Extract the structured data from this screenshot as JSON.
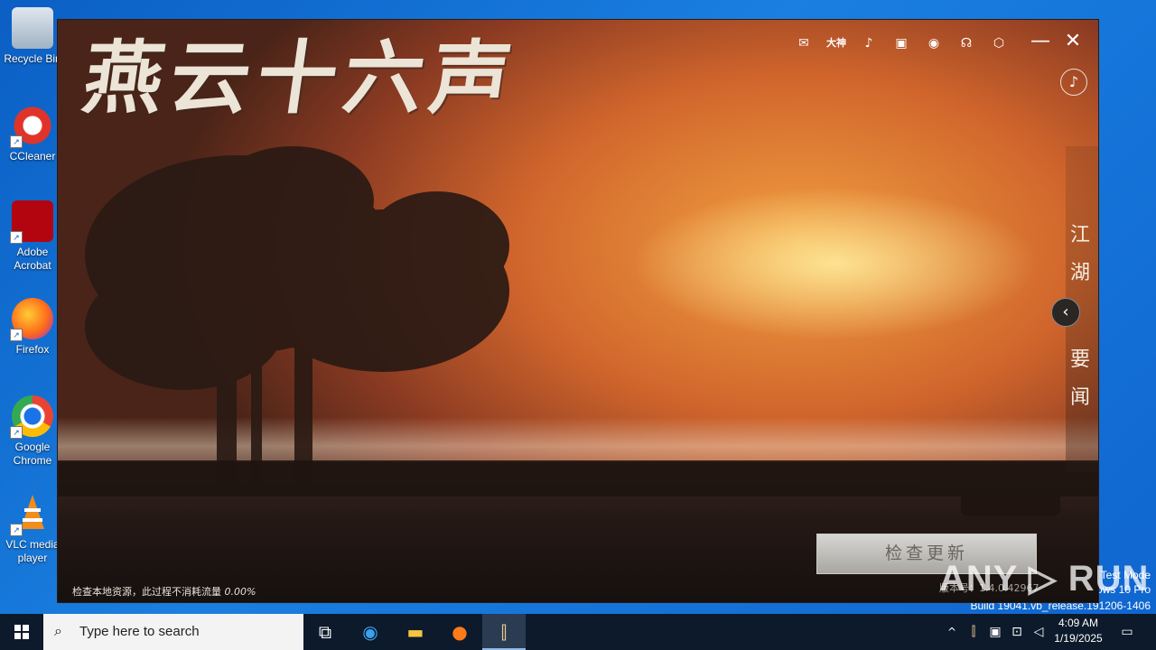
{
  "desktop": {
    "icons": [
      {
        "label": "Recycle Bin"
      },
      {
        "label": "CCleaner"
      },
      {
        "label": "Adobe Acrobat"
      },
      {
        "label": "Firefox"
      },
      {
        "label": "Google Chrome"
      },
      {
        "label": "VLC media player"
      }
    ],
    "watermark_lines": [
      "Test Mode",
      "Windows 10 Pro",
      "Build 19041.vb_release.191206-1406"
    ]
  },
  "launcher": {
    "logo_text": "燕云十六声",
    "toolbar": {
      "wechat": "✉",
      "dashen": "大神",
      "douyin": "♪",
      "bilibili": "▣",
      "weibo": "◉",
      "support": "☊",
      "settings": "⬡"
    },
    "minimize": "—",
    "close": "✕",
    "music": "♪",
    "news_chars": [
      "江",
      "湖",
      "要",
      "闻"
    ],
    "collapse": "‹",
    "update_button": "检查更新",
    "status_label": "检查本地资源，此过程不消耗流量",
    "status_percent": "0.00%",
    "version_label": "版本号：",
    "version": "1.4.0.42967"
  },
  "anyrun_watermark": "ANY ▷ RUN",
  "taskbar": {
    "search_placeholder": "Type here to search",
    "clock_time": "4:09 AM",
    "clock_date": "1/19/2025"
  },
  "colors": {
    "taskbar": "#0d1a2b",
    "desktop": "#1a7fe0",
    "sky_glow": "#f2a040"
  }
}
